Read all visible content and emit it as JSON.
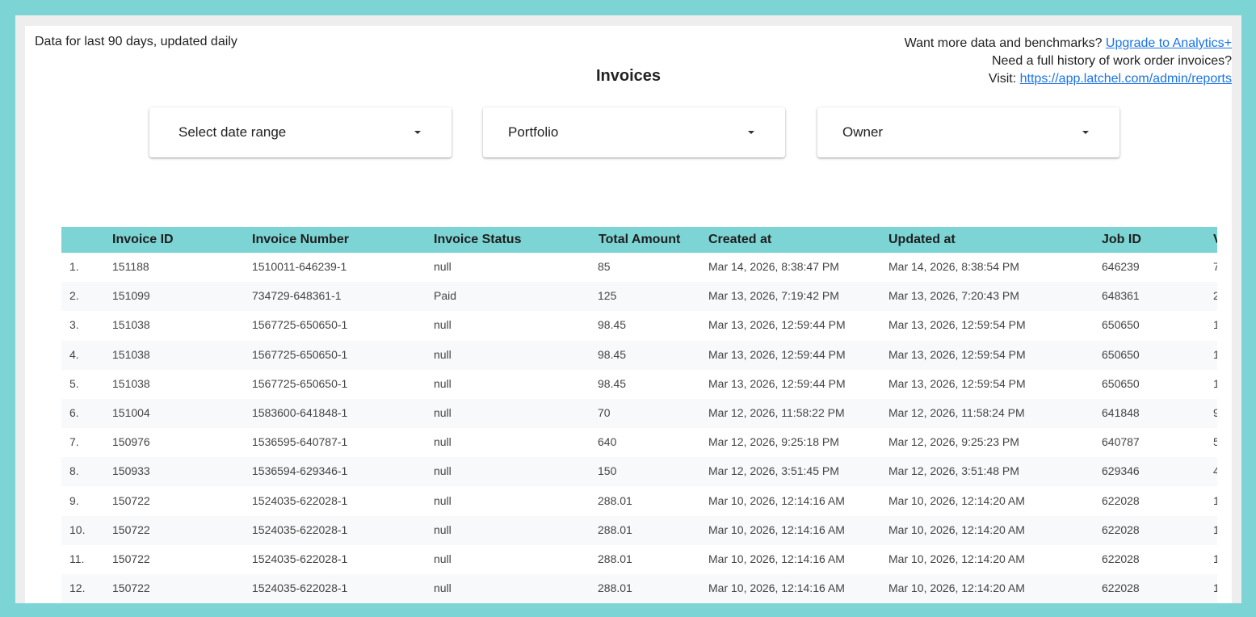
{
  "header": {
    "left_note": "Data for last 90 days, updated daily",
    "right_line1_text": "Want more data and benchmarks? ",
    "right_line1_link": "Upgrade to Analytics+",
    "right_line2": "Need a full history of work order invoices?",
    "right_line3_text": "Visit: ",
    "right_line3_link": "https://app.latchel.com/admin/reports",
    "link_color": "#1a73e8"
  },
  "report": {
    "title": "Invoices"
  },
  "filters": [
    {
      "label": "Select date range",
      "icon": "caret-down-icon"
    },
    {
      "label": "Portfolio",
      "icon": "caret-down-icon"
    },
    {
      "label": "Owner",
      "icon": "caret-down-icon"
    }
  ],
  "table": {
    "header_color": "#7dd4d4",
    "columns": [
      "Invoice ID",
      "Invoice Number",
      "Invoice Status",
      "Total Amount",
      "Created at",
      "Updated at",
      "Job ID",
      "V"
    ],
    "rows": [
      {
        "num": "1.",
        "invoice_id": "151188",
        "invoice_number": "1510011-646239-1",
        "status": "null",
        "total": "85",
        "created": "Mar 14, 2026, 8:38:47 PM",
        "updated": "Mar 14, 2026, 8:38:54 PM",
        "job_id": "646239",
        "v": "7"
      },
      {
        "num": "2.",
        "invoice_id": "151099",
        "invoice_number": "734729-648361-1",
        "status": "Paid",
        "total": "125",
        "created": "Mar 13, 2026, 7:19:42 PM",
        "updated": "Mar 13, 2026, 7:20:43 PM",
        "job_id": "648361",
        "v": "2"
      },
      {
        "num": "3.",
        "invoice_id": "151038",
        "invoice_number": "1567725-650650-1",
        "status": "null",
        "total": "98.45",
        "created": "Mar 13, 2026, 12:59:44 PM",
        "updated": "Mar 13, 2026, 12:59:54 PM",
        "job_id": "650650",
        "v": "1"
      },
      {
        "num": "4.",
        "invoice_id": "151038",
        "invoice_number": "1567725-650650-1",
        "status": "null",
        "total": "98.45",
        "created": "Mar 13, 2026, 12:59:44 PM",
        "updated": "Mar 13, 2026, 12:59:54 PM",
        "job_id": "650650",
        "v": "1"
      },
      {
        "num": "5.",
        "invoice_id": "151038",
        "invoice_number": "1567725-650650-1",
        "status": "null",
        "total": "98.45",
        "created": "Mar 13, 2026, 12:59:44 PM",
        "updated": "Mar 13, 2026, 12:59:54 PM",
        "job_id": "650650",
        "v": "1"
      },
      {
        "num": "6.",
        "invoice_id": "151004",
        "invoice_number": "1583600-641848-1",
        "status": "null",
        "total": "70",
        "created": "Mar 12, 2026, 11:58:22 PM",
        "updated": "Mar 12, 2026, 11:58:24 PM",
        "job_id": "641848",
        "v": "9"
      },
      {
        "num": "7.",
        "invoice_id": "150976",
        "invoice_number": "1536595-640787-1",
        "status": "null",
        "total": "640",
        "created": "Mar 12, 2026, 9:25:18 PM",
        "updated": "Mar 12, 2026, 9:25:23 PM",
        "job_id": "640787",
        "v": "5"
      },
      {
        "num": "8.",
        "invoice_id": "150933",
        "invoice_number": "1536594-629346-1",
        "status": "null",
        "total": "150",
        "created": "Mar 12, 2026, 3:51:45 PM",
        "updated": "Mar 12, 2026, 3:51:48 PM",
        "job_id": "629346",
        "v": "4"
      },
      {
        "num": "9.",
        "invoice_id": "150722",
        "invoice_number": "1524035-622028-1",
        "status": "null",
        "total": "288.01",
        "created": "Mar 10, 2026, 12:14:16 AM",
        "updated": "Mar 10, 2026, 12:14:20 AM",
        "job_id": "622028",
        "v": "1"
      },
      {
        "num": "10.",
        "invoice_id": "150722",
        "invoice_number": "1524035-622028-1",
        "status": "null",
        "total": "288.01",
        "created": "Mar 10, 2026, 12:14:16 AM",
        "updated": "Mar 10, 2026, 12:14:20 AM",
        "job_id": "622028",
        "v": "1"
      },
      {
        "num": "11.",
        "invoice_id": "150722",
        "invoice_number": "1524035-622028-1",
        "status": "null",
        "total": "288.01",
        "created": "Mar 10, 2026, 12:14:16 AM",
        "updated": "Mar 10, 2026, 12:14:20 AM",
        "job_id": "622028",
        "v": "1"
      },
      {
        "num": "12.",
        "invoice_id": "150722",
        "invoice_number": "1524035-622028-1",
        "status": "null",
        "total": "288.01",
        "created": "Mar 10, 2026, 12:14:16 AM",
        "updated": "Mar 10, 2026, 12:14:20 AM",
        "job_id": "622028",
        "v": "1"
      }
    ]
  }
}
